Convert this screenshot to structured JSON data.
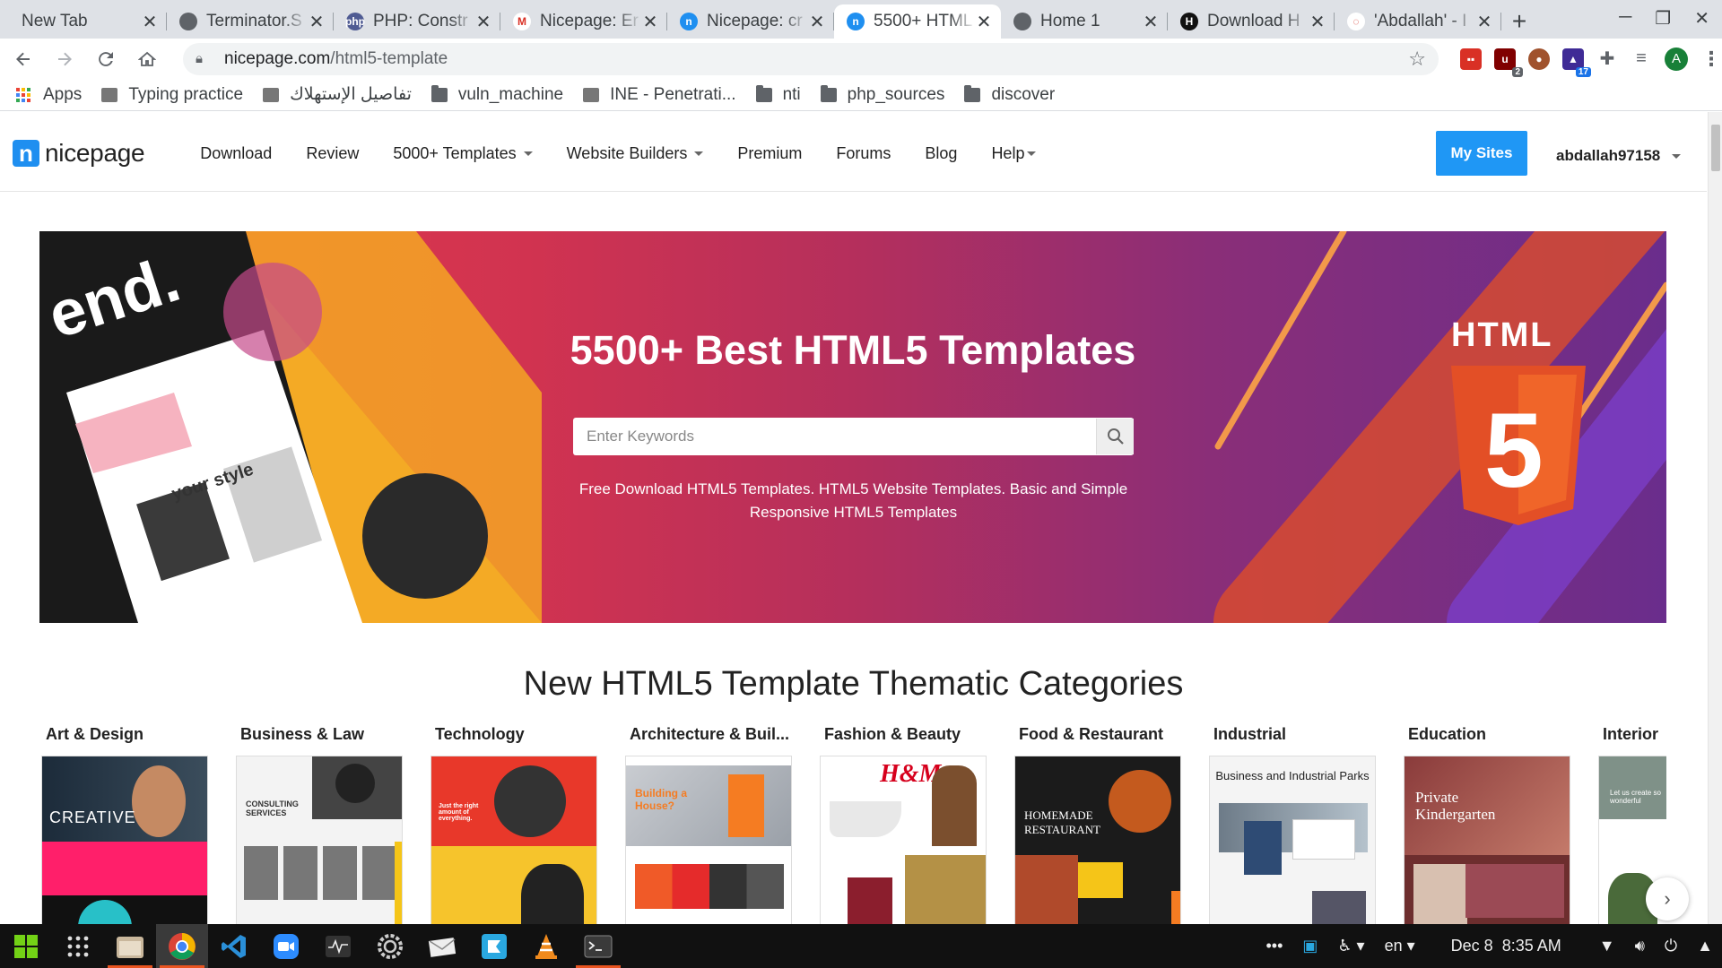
{
  "browser": {
    "tabs": [
      {
        "title": "New Tab",
        "fav_color": "#dee1e6",
        "fav_text": ""
      },
      {
        "title": "Terminator.S",
        "fav_color": "#5f6368",
        "fav_text": ""
      },
      {
        "title": "PHP: Constr",
        "fav_color": "#4f5b93",
        "fav_text": "php"
      },
      {
        "title": "Nicepage: Er",
        "fav_color": "#ffffff",
        "fav_text": "M"
      },
      {
        "title": "Nicepage: cr",
        "fav_color": "#1f8ff0",
        "fav_text": "n"
      },
      {
        "title": "5500+ HTML",
        "fav_color": "#1f8ff0",
        "fav_text": "n"
      },
      {
        "title": "Home 1",
        "fav_color": "#5f6368",
        "fav_text": ""
      },
      {
        "title": "Download H",
        "fav_color": "#111111",
        "fav_text": "H"
      },
      {
        "title": "'Abdallah' - I",
        "fav_color": "#ffffff",
        "fav_text": "◌"
      }
    ],
    "active_tab": 5,
    "url_host": "nicepage.com",
    "url_path": "/html5-template",
    "profile_initial": "A",
    "ext_badges": {
      "ublock": "2",
      "cap": "17"
    },
    "bookmarks": [
      {
        "label": "Apps",
        "type": "apps"
      },
      {
        "label": "Typing practice",
        "type": "page"
      },
      {
        "label": "تفاصيل الإستهلاك",
        "type": "page"
      },
      {
        "label": "vuln_machine",
        "type": "folder"
      },
      {
        "label": "INE - Penetrati...",
        "type": "page"
      },
      {
        "label": "nti",
        "type": "folder"
      },
      {
        "label": "php_sources",
        "type": "folder"
      },
      {
        "label": "discover",
        "type": "folder"
      }
    ]
  },
  "site": {
    "logo_text": "nicepage",
    "nav": [
      {
        "label": "Download",
        "caret": false
      },
      {
        "label": "Review",
        "caret": false
      },
      {
        "label": "5000+ Templates",
        "caret": true
      },
      {
        "label": "Website Builders",
        "caret": true
      },
      {
        "label": "Premium",
        "caret": false
      },
      {
        "label": "Forums",
        "caret": false
      },
      {
        "label": "Blog",
        "caret": false
      },
      {
        "label": "Help",
        "caret": true
      }
    ],
    "mysites_label": "My Sites",
    "username": "abdallah97158",
    "hero": {
      "title": "5500+ Best HTML5 Templates",
      "search_placeholder": "Enter Keywords",
      "subtitle": "Free Download HTML5 Templates. HTML5 Website Templates. Basic and Simple Responsive HTML5 Templates",
      "badge_text": "HTML",
      "badge_number": "5",
      "collage_words": [
        "end.",
        "your style"
      ]
    },
    "section_title": "New HTML5 Template Thematic Categories",
    "categories": [
      {
        "label": "Art & Design",
        "thumb": "art",
        "text": "CREATIVE"
      },
      {
        "label": "Business & Law",
        "thumb": "business",
        "text": "CONSULTING SERVICES"
      },
      {
        "label": "Technology",
        "thumb": "tech",
        "text": "Just the right amount of everything."
      },
      {
        "label": "Architecture & Buil...",
        "thumb": "arch",
        "text": "Building a House?"
      },
      {
        "label": "Fashion & Beauty",
        "thumb": "fashion",
        "text": "H&M"
      },
      {
        "label": "Food & Restaurant",
        "thumb": "food",
        "text": "HOMEMADE RESTAURANT"
      },
      {
        "label": "Industrial",
        "thumb": "industrial",
        "text": "Business and Industrial Parks"
      },
      {
        "label": "Education",
        "thumb": "education",
        "text": "Private Kindergarten"
      },
      {
        "label": "Interior",
        "thumb": "interior",
        "text": "Let us create so wonderful"
      }
    ]
  },
  "taskbar": {
    "language": "en",
    "date": "Dec 8",
    "time": "8:35 AM"
  },
  "colors": {
    "accent": "#1f97f5",
    "hero_start": "#e33b4a",
    "hero_end": "#6a2d8c",
    "html5_orange": "#e34f26"
  }
}
